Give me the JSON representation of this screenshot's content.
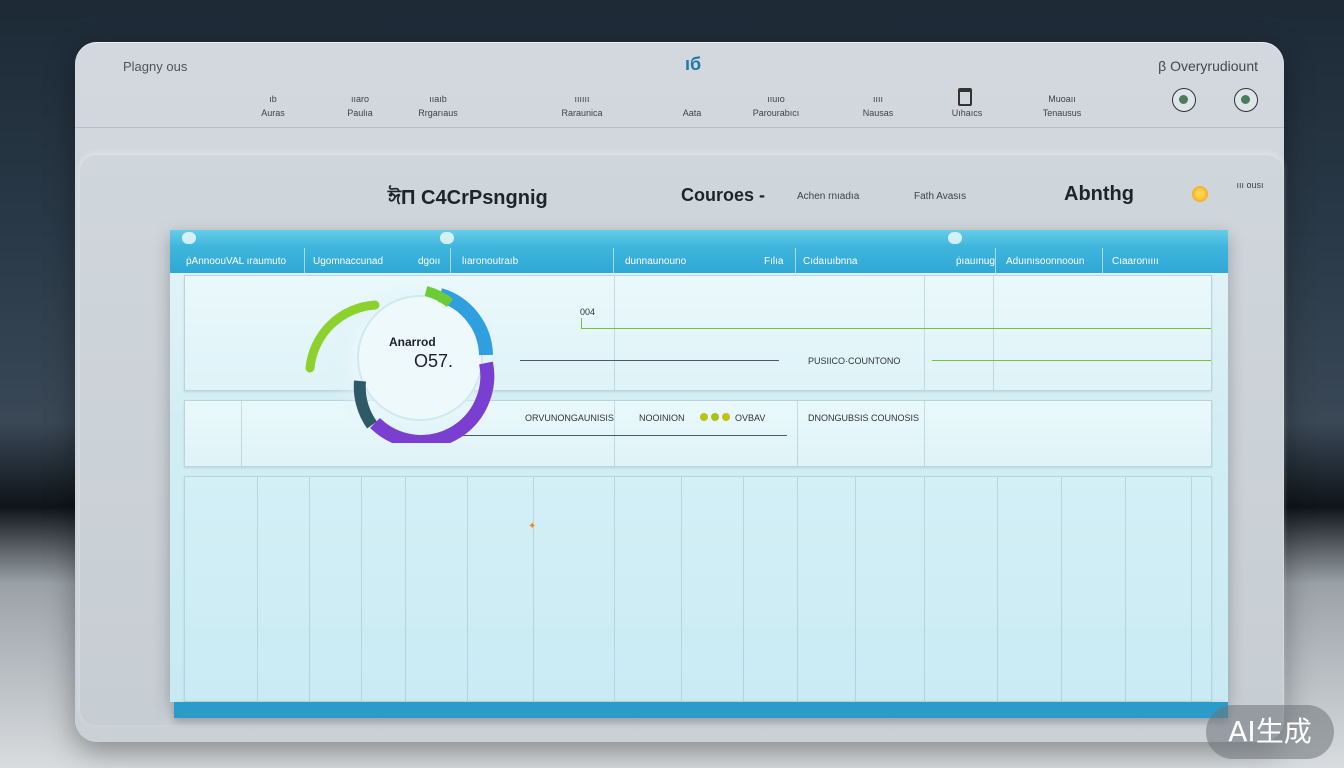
{
  "header": {
    "brand_left": "Plagny ous",
    "logo": "ıб",
    "brand_right": "β Overyrudiount",
    "nav": [
      {
        "top": "ıb",
        "bottom": "Auras"
      },
      {
        "top": "ııaro",
        "bottom": "Paulıa"
      },
      {
        "top": "ııaıb",
        "bottom": "Rrgarıaus"
      },
      {
        "top": "ıııııı",
        "bottom": "Raraunica"
      },
      {
        "top": "",
        "bottom": "Aata"
      },
      {
        "top": "ııuıo",
        "bottom": "Parourabıcı"
      },
      {
        "top": "ıııı",
        "bottom": "Nausas"
      },
      {
        "top": "",
        "bottom": "Uıhaıcs"
      },
      {
        "top": "Muoaıı",
        "bottom": "Tenausus"
      }
    ]
  },
  "panel": {
    "app_title": "ঈΠ C4CrPsngnig",
    "courses_title": "Couroes -",
    "action_link": "Achen rnıadıa",
    "faith_link": "Fath Avasıs",
    "anything_title": "Abnthg",
    "corner_label": "ııı ousı"
  },
  "table": {
    "columns": [
      "ṗAnnoouVAL ıraumuto",
      "Ugomnaccunad",
      "dgoıı",
      "lıaronoutraıb",
      "dunnaunouno",
      "Fılıa",
      "Cıdaıuıbnna",
      "ṗıauınug",
      "Aduınısoonnooun",
      "Cıaaronıııı"
    ],
    "gauge_label": "Anarrod",
    "gauge_value": "O57.",
    "row1_tick": "004",
    "row1_text": "PUSIICO·COUNTONO",
    "row2_text_a": "ORVUNONGAUNISIS",
    "row2_text_b": "NOOINION",
    "row2_text_c": "OVBAV",
    "row2_text_d": "DNONGUBSIS COUNOSIS"
  },
  "watermark": "AI生成",
  "colors": {
    "accent": "#2fa8d6",
    "gauge_green": "#8cd12e",
    "gauge_blue": "#2f9fe0",
    "gauge_purple": "#7a3fd0",
    "line_green": "#78c23a"
  }
}
